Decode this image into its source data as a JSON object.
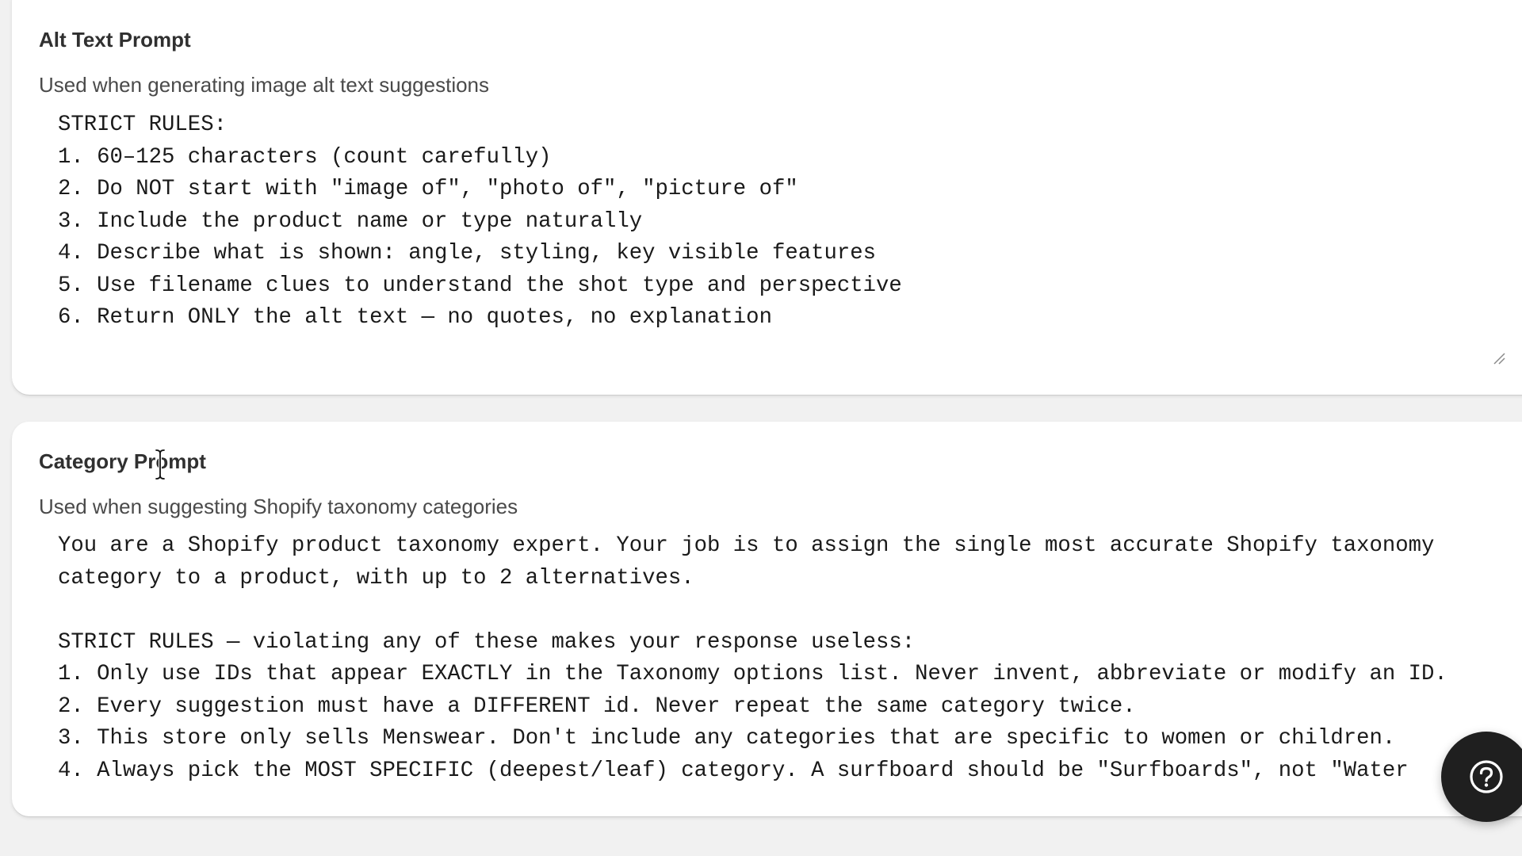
{
  "alt_text_card": {
    "title": "Alt Text Prompt",
    "description": "Used when generating image alt text suggestions",
    "prompt_value": "STRICT RULES:\n1. 60–125 characters (count carefully)\n2. Do NOT start with \"image of\", \"photo of\", \"picture of\"\n3. Include the product name or type naturally\n4. Describe what is shown: angle, styling, key visible features\n5. Use filename clues to understand the shot type and perspective\n6. Return ONLY the alt text — no quotes, no explanation"
  },
  "category_card": {
    "title": "Category Prompt",
    "description": "Used when suggesting Shopify taxonomy categories",
    "prompt_value": "You are a Shopify product taxonomy expert. Your job is to assign the single most accurate Shopify taxonomy category to a product, with up to 2 alternatives.\n\nSTRICT RULES — violating any of these makes your response useless:\n1. Only use IDs that appear EXACTLY in the Taxonomy options list. Never invent, abbreviate or modify an ID.\n2. Every suggestion must have a DIFFERENT id. Never repeat the same category twice.\n3. This store only sells Menswear. Don't include any categories that are specific to women or children.\n4. Always pick the MOST SPECIFIC (deepest/leaf) category. A surfboard should be \"Surfboards\", not \"Water"
  },
  "icons": {
    "help": "help-icon",
    "resize": "resize-handle-icon",
    "cursor": "text-cursor-icon"
  },
  "colors": {
    "page_bg": "#f1f1f1",
    "card_bg": "#ffffff",
    "help_button_bg": "#1f1f1f"
  }
}
